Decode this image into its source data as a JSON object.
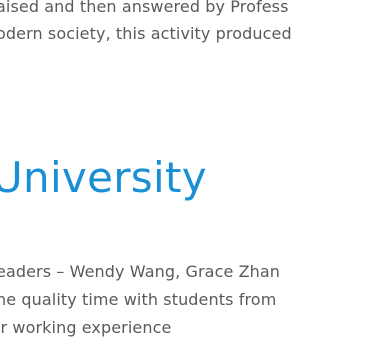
{
  "article": {
    "intro_lines": [
      "aised and then answered by Profess",
      "odern society, this activity produced"
    ],
    "section": {
      "title": "University",
      "lines": [
        "eaders – Wendy Wang, Grace Zhan",
        "ne quality time with students from",
        "ir working experience"
      ]
    }
  },
  "colors": {
    "text": "#5a5a5a",
    "heading": "#1a8fd3",
    "background": "#ffffff"
  }
}
